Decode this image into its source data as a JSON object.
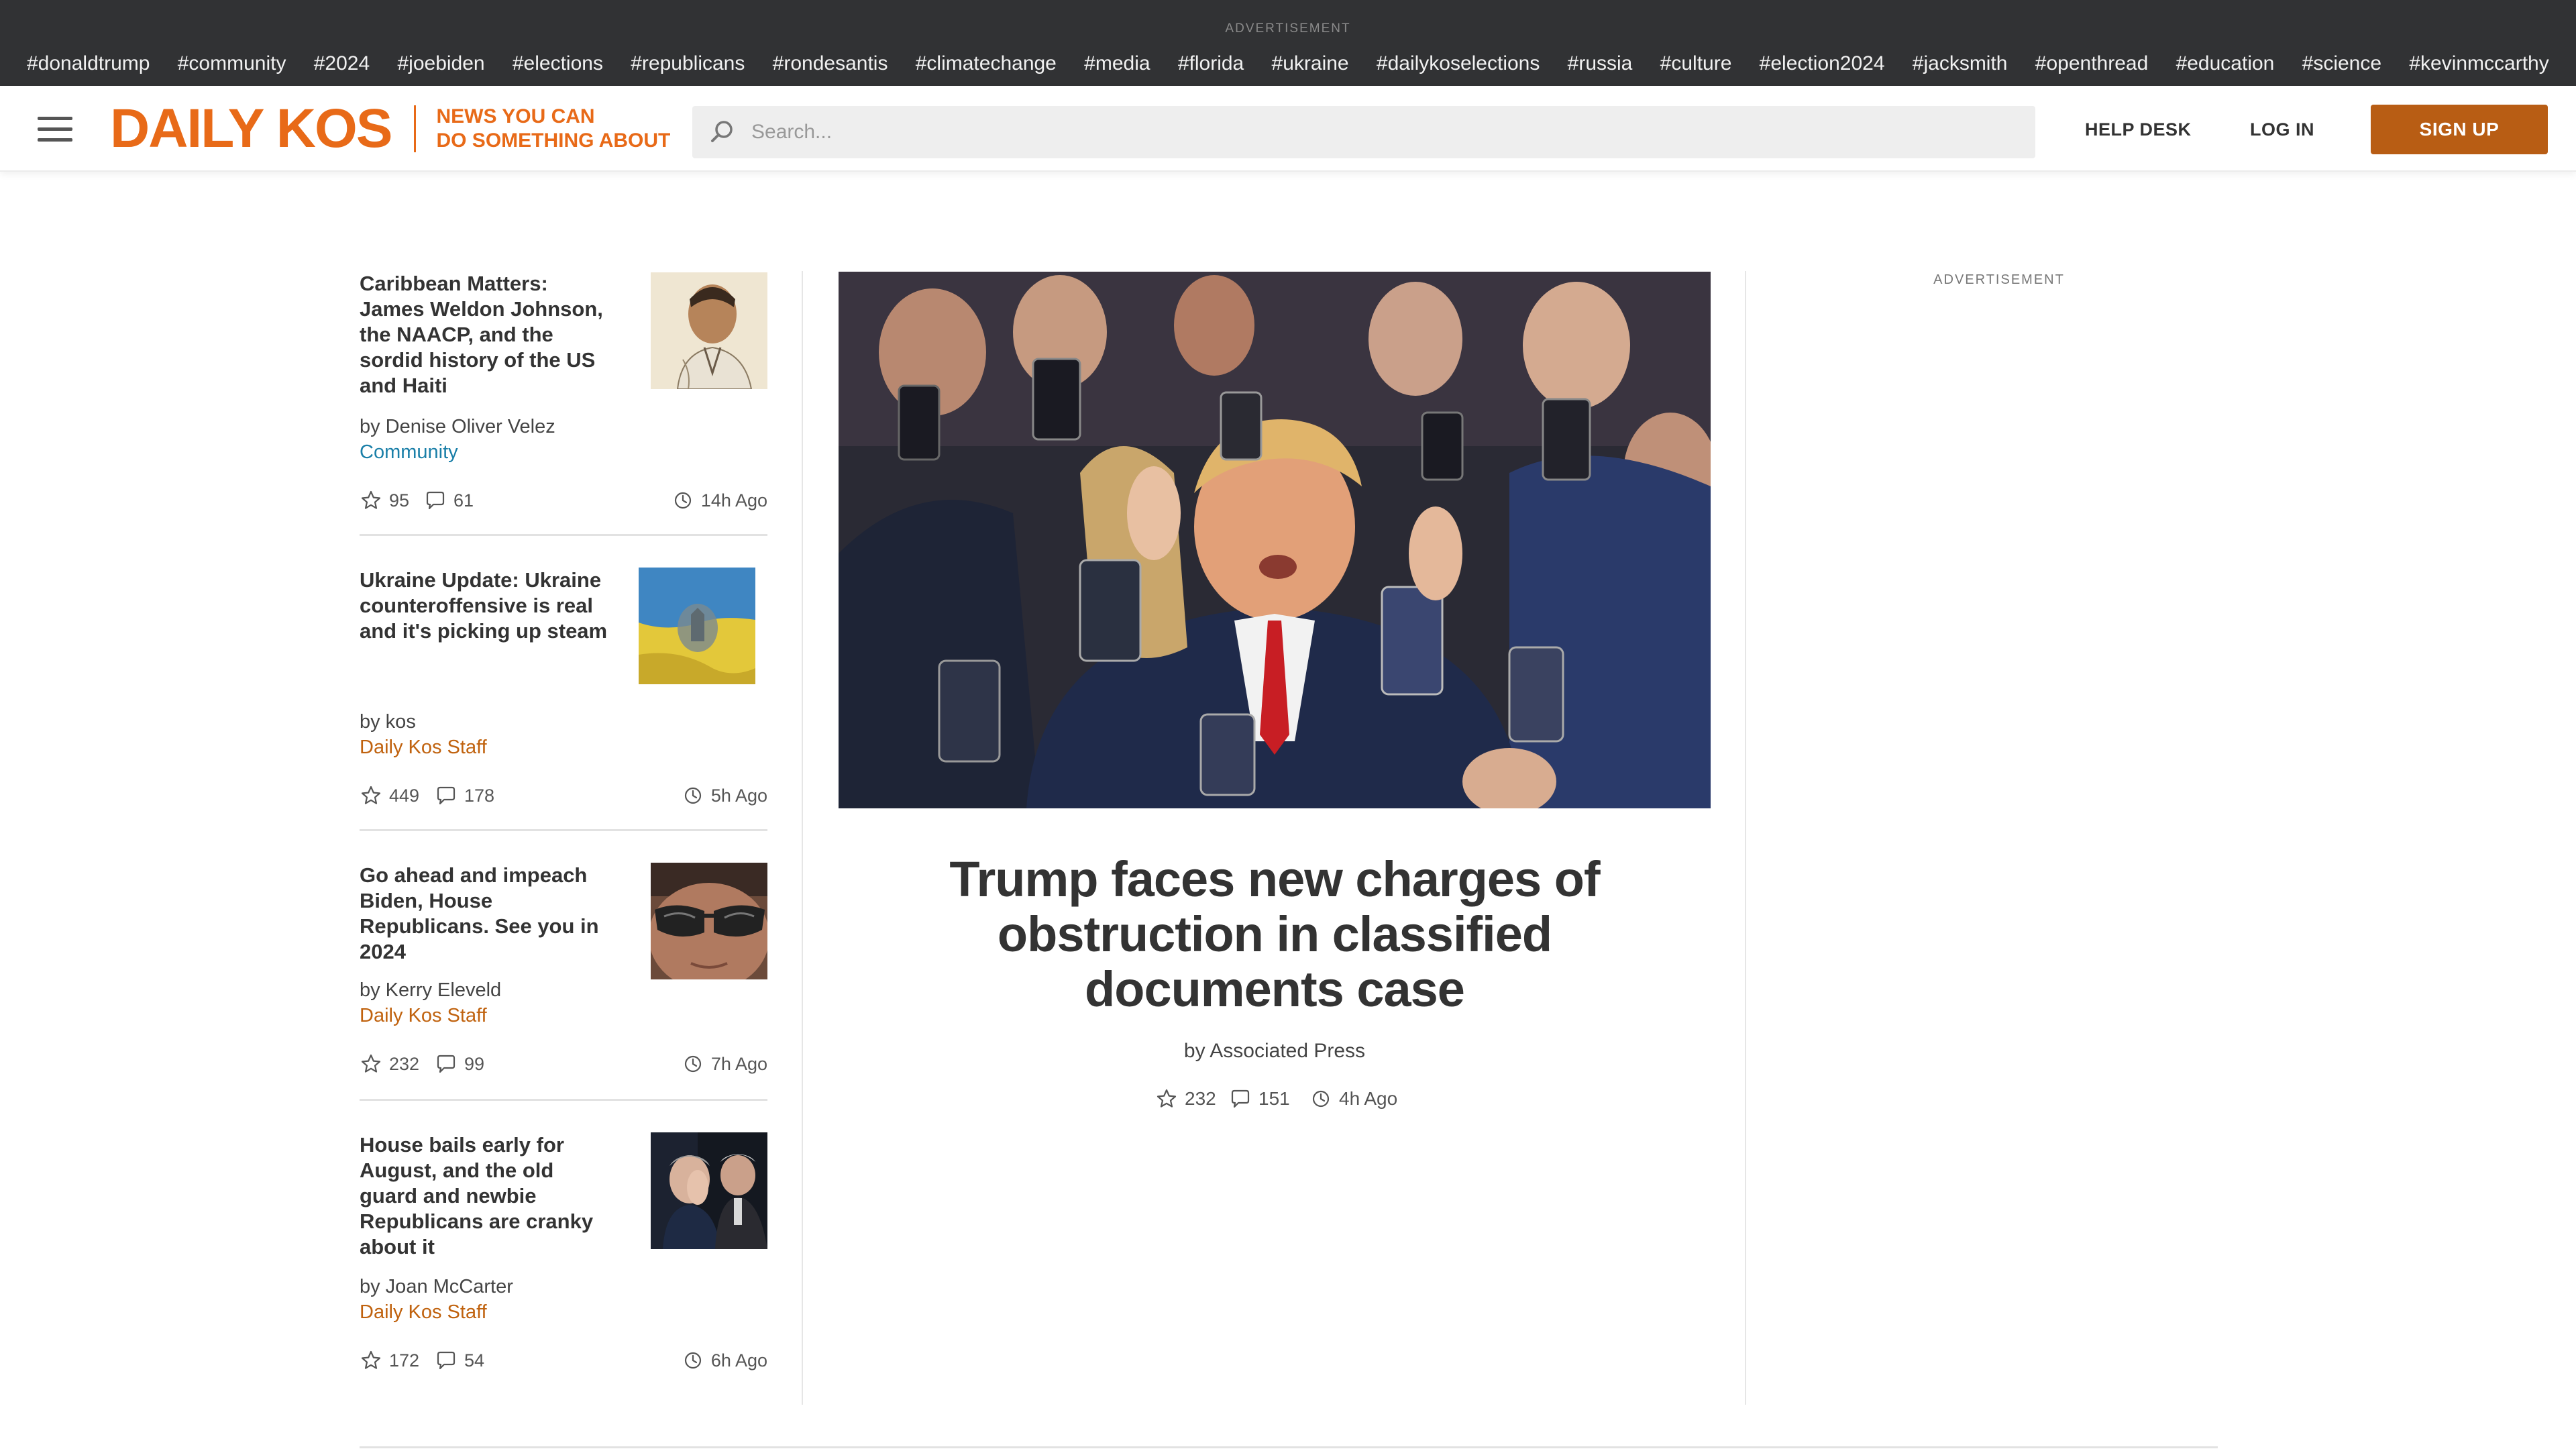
{
  "topbar": {
    "ad_label": "ADVERTISEMENT",
    "tags": [
      "#donaldtrump",
      "#community",
      "#2024",
      "#joebiden",
      "#elections",
      "#republicans",
      "#rondesantis",
      "#climatechange",
      "#media",
      "#florida",
      "#ukraine",
      "#dailykoselections",
      "#russia",
      "#culture",
      "#election2024",
      "#jacksmith",
      "#openthread",
      "#education",
      "#science",
      "#kevinmccarthy"
    ]
  },
  "header": {
    "logo_text": "DAILY KOS",
    "tagline_line1": "NEWS YOU CAN",
    "tagline_line2": "DO SOMETHING ABOUT",
    "search_placeholder": "Search...",
    "help_desk": "HELP DESK",
    "log_in": "LOG IN",
    "sign_up": "SIGN UP",
    "brand_color": "#e86a18",
    "button_color": "#b85d14"
  },
  "stories": [
    {
      "title": "Caribbean Matters: James Weldon Johnson, the NAACP, and the sordid history of the US and Haiti",
      "author": "by Denise Oliver Velez",
      "category": "Community",
      "recommends": "95",
      "comments": "61",
      "time": "14h Ago",
      "thumb": "portrait-sketch"
    },
    {
      "title": "Ukraine Update: Ukraine counteroffensive is real and it's picking up steam",
      "author": "by kos",
      "category": "Daily Kos Staff",
      "recommends": "449",
      "comments": "178",
      "time": "5h Ago",
      "thumb": "ukraine-flag"
    },
    {
      "title": "Go ahead and impeach Biden, House Republicans. See you in 2024",
      "author": "by Kerry Eleveld",
      "category": "Daily Kos Staff",
      "recommends": "232",
      "comments": "99",
      "time": "7h Ago",
      "thumb": "sunglasses-closeup"
    },
    {
      "title": "House bails early for August, and the old guard and newbie Republicans are cranky about it",
      "author": "by Joan McCarter",
      "category": "Daily Kos Staff",
      "recommends": "172",
      "comments": "54",
      "time": "6h Ago",
      "thumb": "frustrated-politician"
    }
  ],
  "featured": {
    "title": "Trump faces new charges of obstruction in classified documents case",
    "author": "by Associated Press",
    "recommends": "232",
    "comments": "151",
    "time": "4h Ago",
    "image": "crowd-with-phones"
  },
  "sidebar": {
    "ad_label": "ADVERTISEMENT"
  }
}
